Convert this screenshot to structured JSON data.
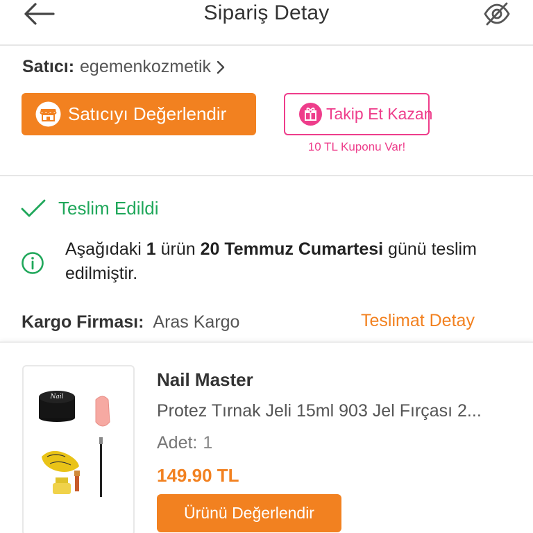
{
  "header": {
    "title": "Sipariş Detay",
    "back_icon": "arrow-left-icon",
    "visibility_icon": "eye-off-icon"
  },
  "seller": {
    "label": "Satıcı:",
    "name": "egemenkozmetik",
    "rate_button_label": "Satıcıyı Değerlendir",
    "follow_button_label": "Takip Et Kazan",
    "coupon_note": "10 TL Kuponu Var!"
  },
  "order_status": {
    "status": "Teslim Edildi",
    "info_prefix": "Aşağıdaki ",
    "info_count": "1",
    "info_mid": " ürün ",
    "info_date": "20 Temmuz Cumartesi",
    "info_suffix": " günü teslim edilmiştir."
  },
  "shipping": {
    "company_label": "Kargo Firması:",
    "company_name": "Aras Kargo",
    "delivery_link": "Teslimat Detay"
  },
  "product": {
    "brand": "Nail Master",
    "name": "Protez Tırnak Jeli 15ml 903 Jel Fırçası 2...",
    "qty_label": "Adet:",
    "qty_value": "1",
    "price": "149.90 TL",
    "rate_button_label": "Ürünü Değerlendir",
    "image_text": "Nail"
  },
  "colors": {
    "accent": "#f28120",
    "pink": "#ee3d8b",
    "success": "#1fa75a"
  }
}
